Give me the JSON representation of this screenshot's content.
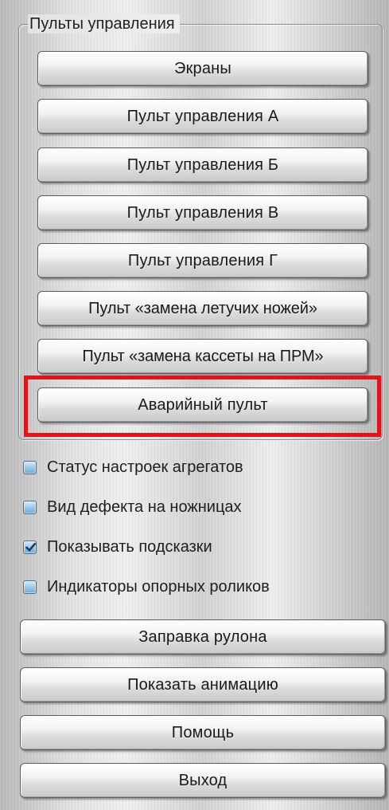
{
  "group": {
    "title": "Пульты управления",
    "buttons": [
      "Экраны",
      "Пульт управления А",
      "Пульт управления Б",
      "Пульт управления В",
      "Пульт управления Г",
      "Пульт «замена летучих ножей»",
      "Пульт «замена кассеты на ПРМ»",
      "Аварийный пульт"
    ]
  },
  "checkboxes": [
    {
      "label": "Статус настроек агрегатов",
      "checked": false
    },
    {
      "label": "Вид дефекта на ножницах",
      "checked": false
    },
    {
      "label": "Показывать подсказки",
      "checked": true
    },
    {
      "label": "Индикаторы опорных роликов",
      "checked": false
    }
  ],
  "actions": [
    "Заправка рулона",
    "Показать анимацию",
    "Помощь",
    "Выход"
  ],
  "icons": {
    "checkmark": "checkmark-icon"
  },
  "colors": {
    "highlight": "#e0141c",
    "checkbox_fill": "#8cbde3"
  }
}
